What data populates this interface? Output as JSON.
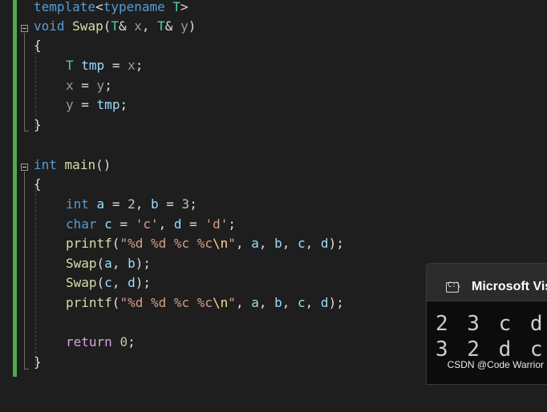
{
  "editor": {
    "template_kw": "template",
    "typename_kw": "typename",
    "type_param": "T",
    "void_kw": "void",
    "swap_name": "Swap",
    "param_x": "x",
    "param_y": "y",
    "tmp_name": "tmp",
    "int_kw": "int",
    "main_name": "main",
    "var_a": "a",
    "var_b": "b",
    "var_c": "c",
    "var_d": "d",
    "num_2": "2",
    "num_3": "3",
    "char_kw": "char",
    "char_c": "'c'",
    "char_d": "'d'",
    "printf_name": "printf",
    "fmt_1": "\"%d %d %c %c",
    "fmt_esc": "\\n",
    "fmt_close": "\"",
    "return_kw": "return",
    "num_0": "0"
  },
  "console": {
    "title": "Microsoft Visu",
    "icon": "terminal-icon",
    "output_line_1": "2 3 c d",
    "output_line_2": "3 2 d c"
  },
  "watermark": "CSDN @Code Warrior",
  "colors": {
    "background": "#1e1e1e",
    "change_bar": "#4fa84f",
    "keyword": "#569cd6",
    "type": "#4ec9b0",
    "function": "#dcdcaa",
    "identifier": "#9cdcfe",
    "number": "#b5cea8",
    "string": "#d69d85"
  }
}
